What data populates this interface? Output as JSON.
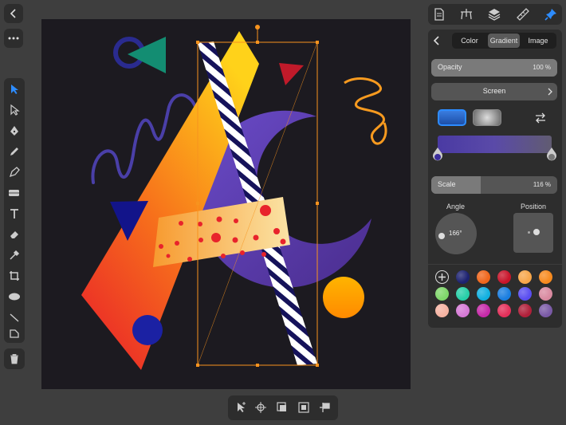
{
  "topleft": {
    "back_icon": "chevron-left-icon",
    "more_icon": "ellipsis-icon"
  },
  "toolbar": {
    "tools": [
      "move-tool-icon",
      "node-tool-icon",
      "pen-tool-icon",
      "pencil-tool-icon",
      "vector-brush-icon",
      "fill-tool-icon",
      "text-tool-icon",
      "eraser-tool-icon",
      "color-picker-icon",
      "crop-tool-icon",
      "ellipse-tool-icon",
      "line-tool-icon",
      "transparency-tool-icon"
    ],
    "delete_icon": "trash-icon",
    "active_color": "#2d8cff"
  },
  "topbar": {
    "icons": [
      "document-icon",
      "layers-tree-icon",
      "layers-icon",
      "ruler-icon",
      "pin-icon"
    ]
  },
  "panel": {
    "tabs": {
      "color": "Color",
      "gradient": "Gradient",
      "image": "Image"
    },
    "opacity": {
      "label": "Opacity",
      "value": "100 %",
      "level": 1.0
    },
    "blend_mode": "Screen",
    "scale": {
      "label": "Scale",
      "value": "116 %",
      "level": 0.39
    },
    "angle": {
      "label": "Angle",
      "value": "166°"
    },
    "position": {
      "label": "Position"
    },
    "gradient_color": "#4a3aa3",
    "swatches": [
      "#1d2270",
      "#f0661b",
      "#c8142a",
      "#f7a64a",
      "#f78a1e",
      "#7fd66a",
      "#27cfa8",
      "#12b0e0",
      "#1a7ee0",
      "#5a4ef0",
      "#d98aa0",
      "#f5b3a2",
      "#d67ad6",
      "#c52aa8",
      "#e3305a",
      "#b0203a",
      "#7a5aa6"
    ]
  },
  "bottombar": {
    "icons": [
      "select-pointer-icon",
      "crosshair-icon",
      "align-front-icon",
      "align-center-icon",
      "flag-icon"
    ]
  }
}
